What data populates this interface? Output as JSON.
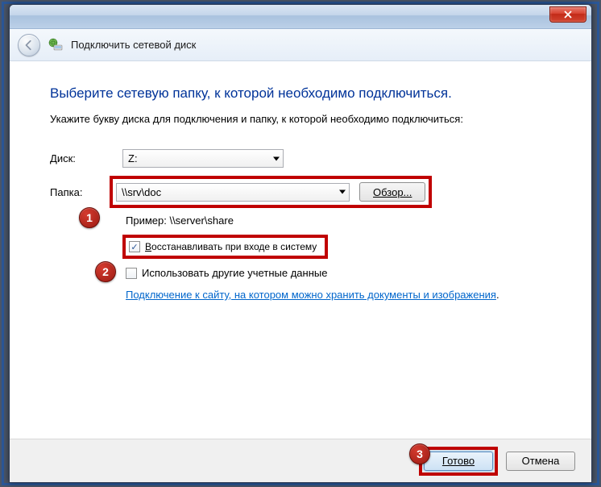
{
  "window": {
    "title": "Подключить сетевой диск"
  },
  "content": {
    "heading": "Выберите сетевую папку, к которой необходимо подключиться.",
    "instruction": "Укажите букву диска для подключения и папку, к которой необходимо подключиться:",
    "drive_label_pre": "Д",
    "drive_label_post": "иск:",
    "drive_value": "Z:",
    "folder_label_pre": "П",
    "folder_label_post": "апка:",
    "folder_value": "\\\\srv\\doc",
    "browse_button": "Обзор...",
    "example": "Пример: \\\\server\\share",
    "reconnect_label_pre": "В",
    "reconnect_label_post": "осстанавливать при входе в систему",
    "othercreds_label": "Использовать другие учетные ",
    "othercreds_underline": "д",
    "othercreds_label2": "анные",
    "link_text": "Подключение к сайту, на котором можно хранить документы и изображения",
    "link_dot": "."
  },
  "footer": {
    "ok": "Готово",
    "cancel": "Отмена"
  },
  "badges": {
    "b1": "1",
    "b2": "2",
    "b3": "3"
  },
  "annotation_color": "#c00000"
}
